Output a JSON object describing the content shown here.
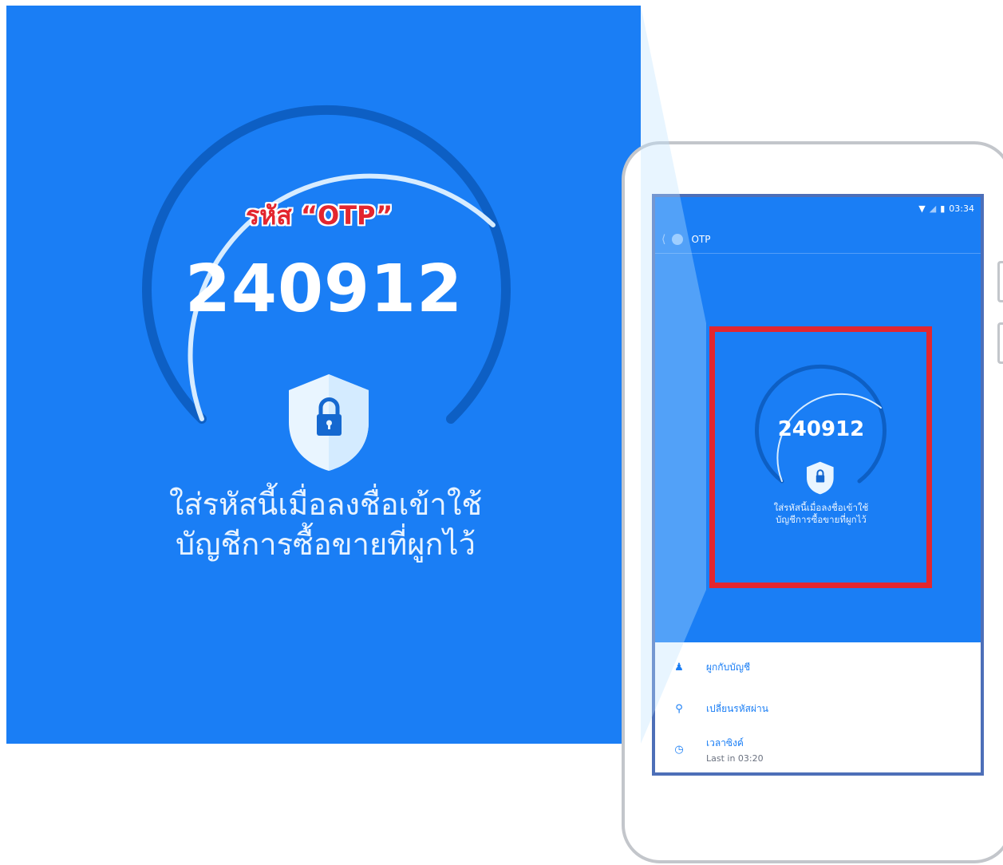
{
  "zoom": {
    "label": "รหัส “OTP”",
    "code": "240912",
    "description_line1": "ใส่รหัสนี้เมื่อลงชื่อเข้าใช้",
    "description_line2": "บัญชีการซื้อขายที่ผูกไว้"
  },
  "status_bar": {
    "time": "03:34"
  },
  "header": {
    "title": "OTP"
  },
  "otp": {
    "code": "240912",
    "description_line1": "ใส่รหัสนี้เมื่อลงชื่อเข้าใช้",
    "description_line2": "บัญชีการซื้อขายที่ผูกไว้"
  },
  "menu": {
    "items": [
      {
        "icon": "user-link-icon",
        "label": "ผูกกับบัญชี"
      },
      {
        "icon": "key-icon",
        "label": "เปลี่ยนรหัสผ่าน"
      },
      {
        "icon": "timer-icon",
        "label": "เวลาซิงค์",
        "sub": "Last in 03:20"
      }
    ]
  },
  "colors": {
    "primary_blue": "#1a7ef5",
    "highlight_red": "#e3262f",
    "screen_border": "#4d6fb8"
  }
}
